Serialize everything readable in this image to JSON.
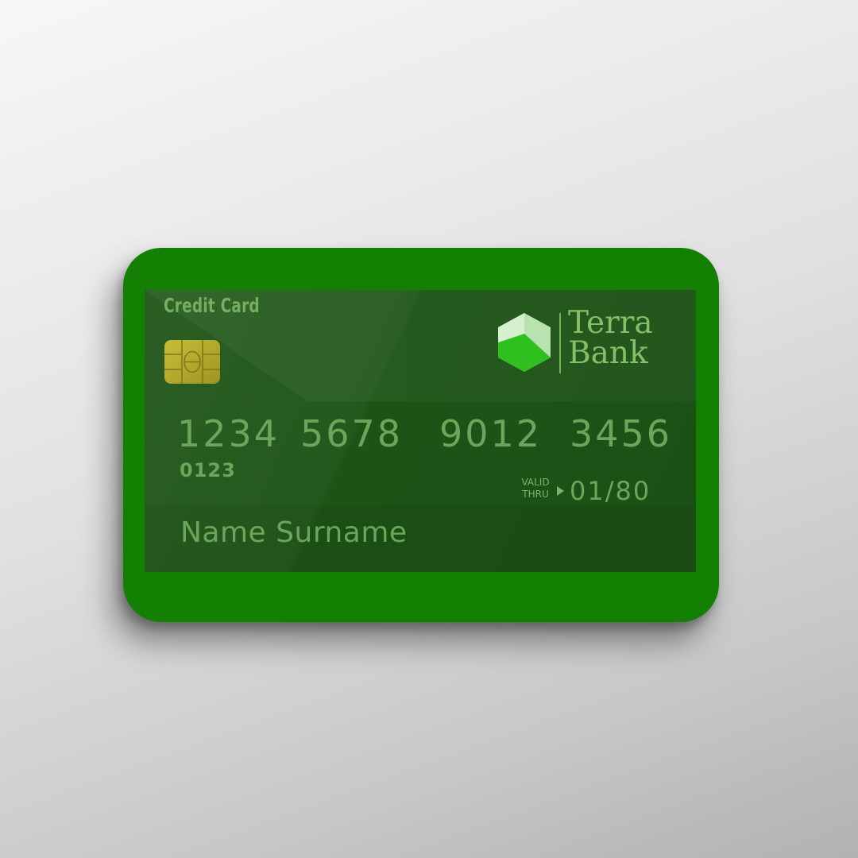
{
  "card": {
    "type_label": "Credit Card",
    "bank_name_line1": "Terra",
    "bank_name_line2": "Bank",
    "number_groups": [
      "1234",
      "5678",
      "9012",
      "3456"
    ],
    "sub_number": "0123",
    "valid_label_line1": "VALID",
    "valid_label_line2": "THRU",
    "expiry": "01/80",
    "holder_name": "Name Surname"
  },
  "icons": {
    "chip": "emv-chip-icon",
    "logo": "hexagon-logo-icon",
    "arrow": "triangle-right-icon"
  },
  "colors": {
    "card_border": "#138003",
    "card_panel": "#1d5416",
    "text_green": "#6aa75a",
    "logo_light": "#b8e3b0",
    "logo_bright": "#2fc01e",
    "chip_gold": "#b7ac2c"
  }
}
